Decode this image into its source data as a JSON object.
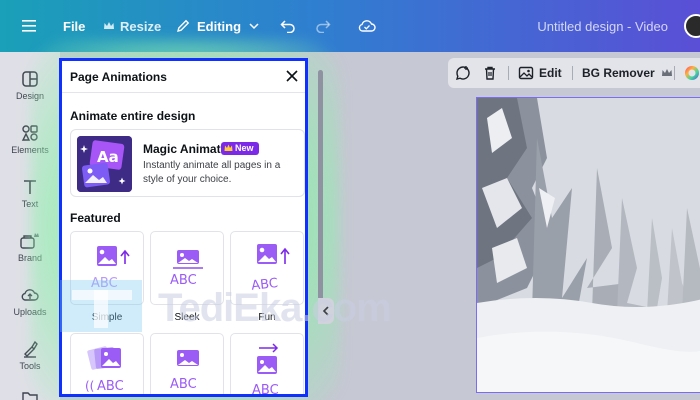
{
  "topbar": {
    "file_label": "File",
    "resize_label": "Resize",
    "editing_label": "Editing",
    "design_title": "Untitled design - Video"
  },
  "sidebar": {
    "items": [
      {
        "label": "Design",
        "icon": "design-icon"
      },
      {
        "label": "Elements",
        "icon": "elements-icon"
      },
      {
        "label": "Text",
        "icon": "text-icon"
      },
      {
        "label": "Brand",
        "icon": "brand-icon"
      },
      {
        "label": "Uploads",
        "icon": "uploads-icon"
      },
      {
        "label": "Tools",
        "icon": "tools-icon"
      }
    ]
  },
  "canvas_toolbar": {
    "edit_label": "Edit",
    "bg_remover_label": "BG Remover"
  },
  "panel": {
    "title": "Page Animations",
    "section_entire": "Animate entire design",
    "magic": {
      "name": "Magic Animate",
      "badge": "New",
      "description": "Instantly animate all pages in a style of your choice.",
      "thumb_text": "Aa"
    },
    "section_featured": "Featured",
    "featured": [
      {
        "label": "Simple",
        "sample": "ABC"
      },
      {
        "label": "Sleek",
        "sample": "ABC"
      },
      {
        "label": "Fun",
        "sample": "ABC"
      },
      {
        "label": "",
        "sample": "ABC"
      },
      {
        "label": "",
        "sample": "ABC"
      },
      {
        "label": "",
        "sample": "ABC"
      }
    ]
  },
  "watermark": {
    "text": "TediEka.com"
  },
  "colors": {
    "accent": "#7d2ae8",
    "highlight_border": "#1030ff",
    "selection": "#7b6cf5"
  }
}
